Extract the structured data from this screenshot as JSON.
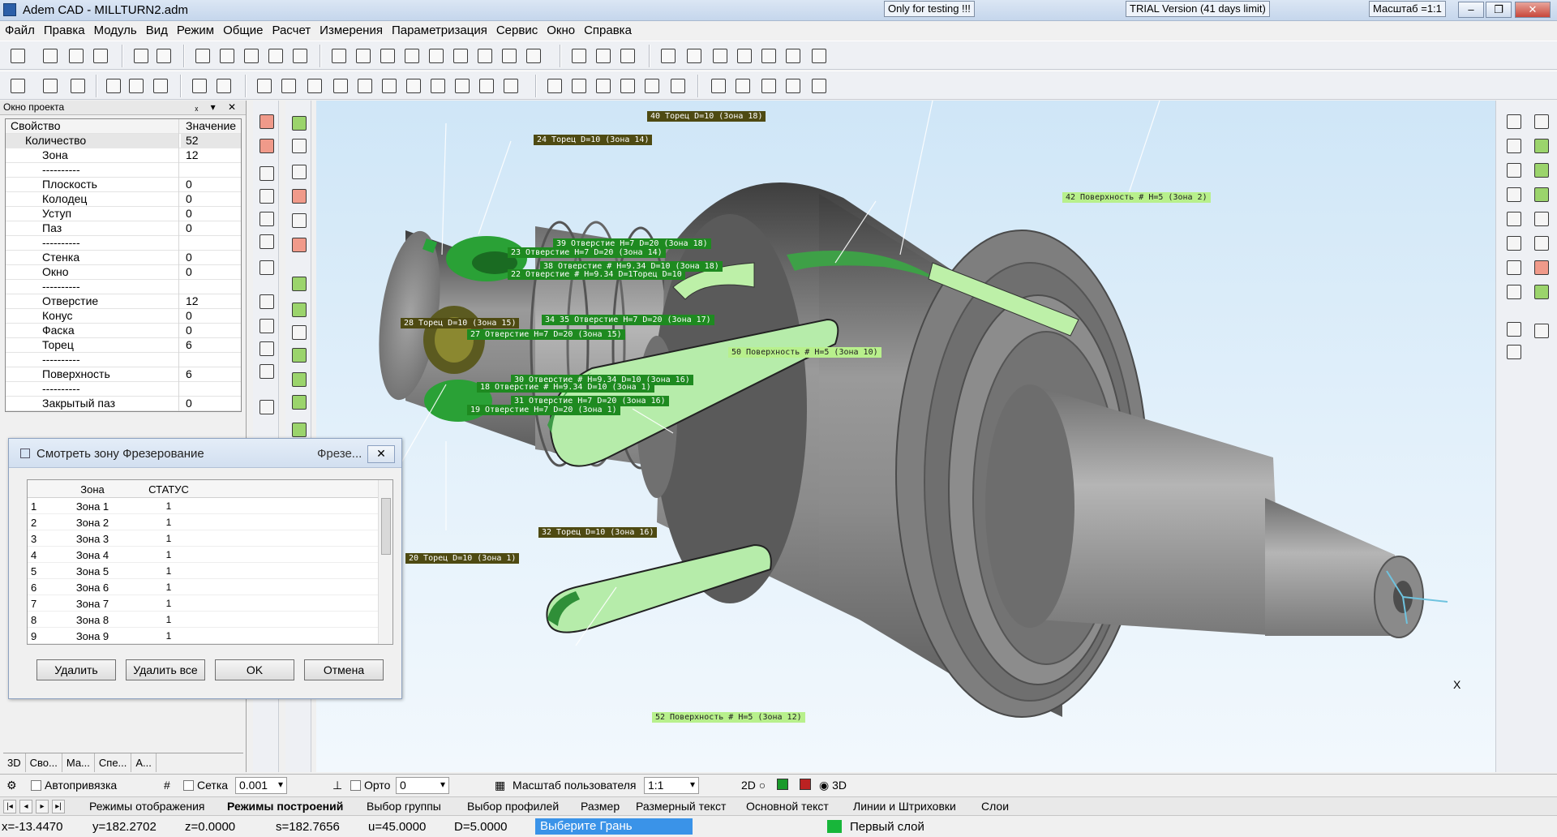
{
  "window": {
    "title": "Adem CAD - MILLTURN2.adm",
    "badge_testing": "Only for testing !!!",
    "badge_trial": "TRIAL Version (41 days limit)",
    "badge_scale": "Масштаб =1:1",
    "btn_minimize": "‒",
    "btn_maximize": "❐",
    "btn_close": "✕"
  },
  "menu": [
    "Файл",
    "Правка",
    "Модуль",
    "Вид",
    "Режим",
    "Общие",
    "Расчет",
    "Измерения",
    "Параметризация",
    "Сервис",
    "Окно",
    "Справка"
  ],
  "project": {
    "title": "Окно проекта",
    "controls": "ₓ ▾ ✕",
    "col_property": "Свойство",
    "col_value": "Значение",
    "root_label": "Количество",
    "root_value": "52",
    "rows": [
      {
        "k": "Зона",
        "v": "12"
      },
      {
        "k": "----------",
        "v": ""
      },
      {
        "k": "Плоскость",
        "v": "0"
      },
      {
        "k": "Колодец",
        "v": "0"
      },
      {
        "k": "Уступ",
        "v": "0"
      },
      {
        "k": "Паз",
        "v": "0"
      },
      {
        "k": "----------",
        "v": ""
      },
      {
        "k": "Стенка",
        "v": "0"
      },
      {
        "k": "Окно",
        "v": "0"
      },
      {
        "k": "----------",
        "v": ""
      },
      {
        "k": "Отверстие",
        "v": "12"
      },
      {
        "k": "Конус",
        "v": "0"
      },
      {
        "k": "Фаска",
        "v": "0"
      },
      {
        "k": "Торец",
        "v": "6"
      },
      {
        "k": "----------",
        "v": ""
      },
      {
        "k": "Поверхность",
        "v": "6"
      },
      {
        "k": "----------",
        "v": ""
      },
      {
        "k": "Закрытый паз",
        "v": "0"
      }
    ],
    "tabs": [
      "3D",
      "Сво...",
      "Ма...",
      "Спе...",
      "А..."
    ]
  },
  "viewport_labels": [
    {
      "text": "40 Торец D=10 (Зона 18)",
      "tone": "dark"
    },
    {
      "text": "24 Торец D=10 (Зона 14)",
      "tone": "dark"
    },
    {
      "text": "42 Поверхность # H=5  (Зона  2)",
      "tone": "light"
    },
    {
      "text": "39 Отверстие H=7 D=20 (Зона 18)",
      "tone": "mid"
    },
    {
      "text": "23 Отверстие H=7 D=20 (Зона 14)",
      "tone": "mid"
    },
    {
      "text": "38 Отверстие # H=9.34 D=10 (Зона 18)",
      "tone": "mid"
    },
    {
      "text": "22 Отверстие # H=9.34 D=1Торец D=10",
      "tone": "mid"
    },
    {
      "text": "28 Торец D=10 (Зона 15)",
      "tone": "dark"
    },
    {
      "text": "34 35 Отверстие H=7 D=20 (Зона 17)",
      "tone": "mid"
    },
    {
      "text": "27 Отверстие H=7 D=20 (Зона 15)",
      "tone": "mid"
    },
    {
      "text": "50 Поверхность # H=5  (Зона 10)",
      "tone": "light"
    },
    {
      "text": "30 Отверстие # H=9.34 D=10 (Зона 16)",
      "tone": "mid"
    },
    {
      "text": "18 Отверстие # H=9.34 D=10 (Зона 1)",
      "tone": "mid"
    },
    {
      "text": "31 Отверстие H=7 D=20 (Зона 16)",
      "tone": "mid"
    },
    {
      "text": "19 Отверстие H=7 D=20 (Зона  1)",
      "tone": "mid"
    },
    {
      "text": "32 Торец D=10 (Зона 16)",
      "tone": "dark"
    },
    {
      "text": "20 Торец D=10 (Зона  1)",
      "tone": "dark"
    },
    {
      "text": "52 Поверхность # H=5  (Зона 12)",
      "tone": "light"
    }
  ],
  "axis_label": "X",
  "dialog": {
    "title": "Смотреть зону Фрезерование",
    "title_right": "Фрезе...",
    "close": "✕",
    "col_zone": "Зона",
    "col_status": "СТАТУС",
    "rows": [
      {
        "n": "1",
        "zone": "Зона 1",
        "status": "1"
      },
      {
        "n": "2",
        "zone": "Зона 2",
        "status": "1"
      },
      {
        "n": "3",
        "zone": "Зона 3",
        "status": "1"
      },
      {
        "n": "4",
        "zone": "Зона 4",
        "status": "1"
      },
      {
        "n": "5",
        "zone": "Зона 5",
        "status": "1"
      },
      {
        "n": "6",
        "zone": "Зона 6",
        "status": "1"
      },
      {
        "n": "7",
        "zone": "Зона 7",
        "status": "1"
      },
      {
        "n": "8",
        "zone": "Зона 8",
        "status": "1"
      },
      {
        "n": "9",
        "zone": "Зона 9",
        "status": "1"
      }
    ],
    "btn_delete": "Удалить",
    "btn_delete_all": "Удалить все",
    "btn_ok": "OK",
    "btn_cancel": "Отмена"
  },
  "options": {
    "autosnap": "Автопривязка",
    "grid": "Сетка",
    "grid_value": "0.001",
    "ortho": "Орто",
    "ortho_value": "0",
    "user_scale": "Масштаб пользователя",
    "user_scale_value": "1:1",
    "mode_2d": "2D",
    "mode_3d": "3D"
  },
  "tabs": [
    "Режимы отображения",
    "Режимы построений",
    "Выбор группы",
    "Выбор профилей",
    "Размер",
    "Размерный текст",
    "Основной текст",
    "Линии и Штриховки",
    "Слои"
  ],
  "active_tab": "Режимы построений",
  "status": {
    "x": "x=-13.4470",
    "y": "y=182.2702",
    "z": "z=0.0000",
    "s": "s=182.7656",
    "u": "u=45.0000",
    "d": "D=5.0000",
    "hint": "Выберите Грань",
    "layer": "Первый слой"
  }
}
